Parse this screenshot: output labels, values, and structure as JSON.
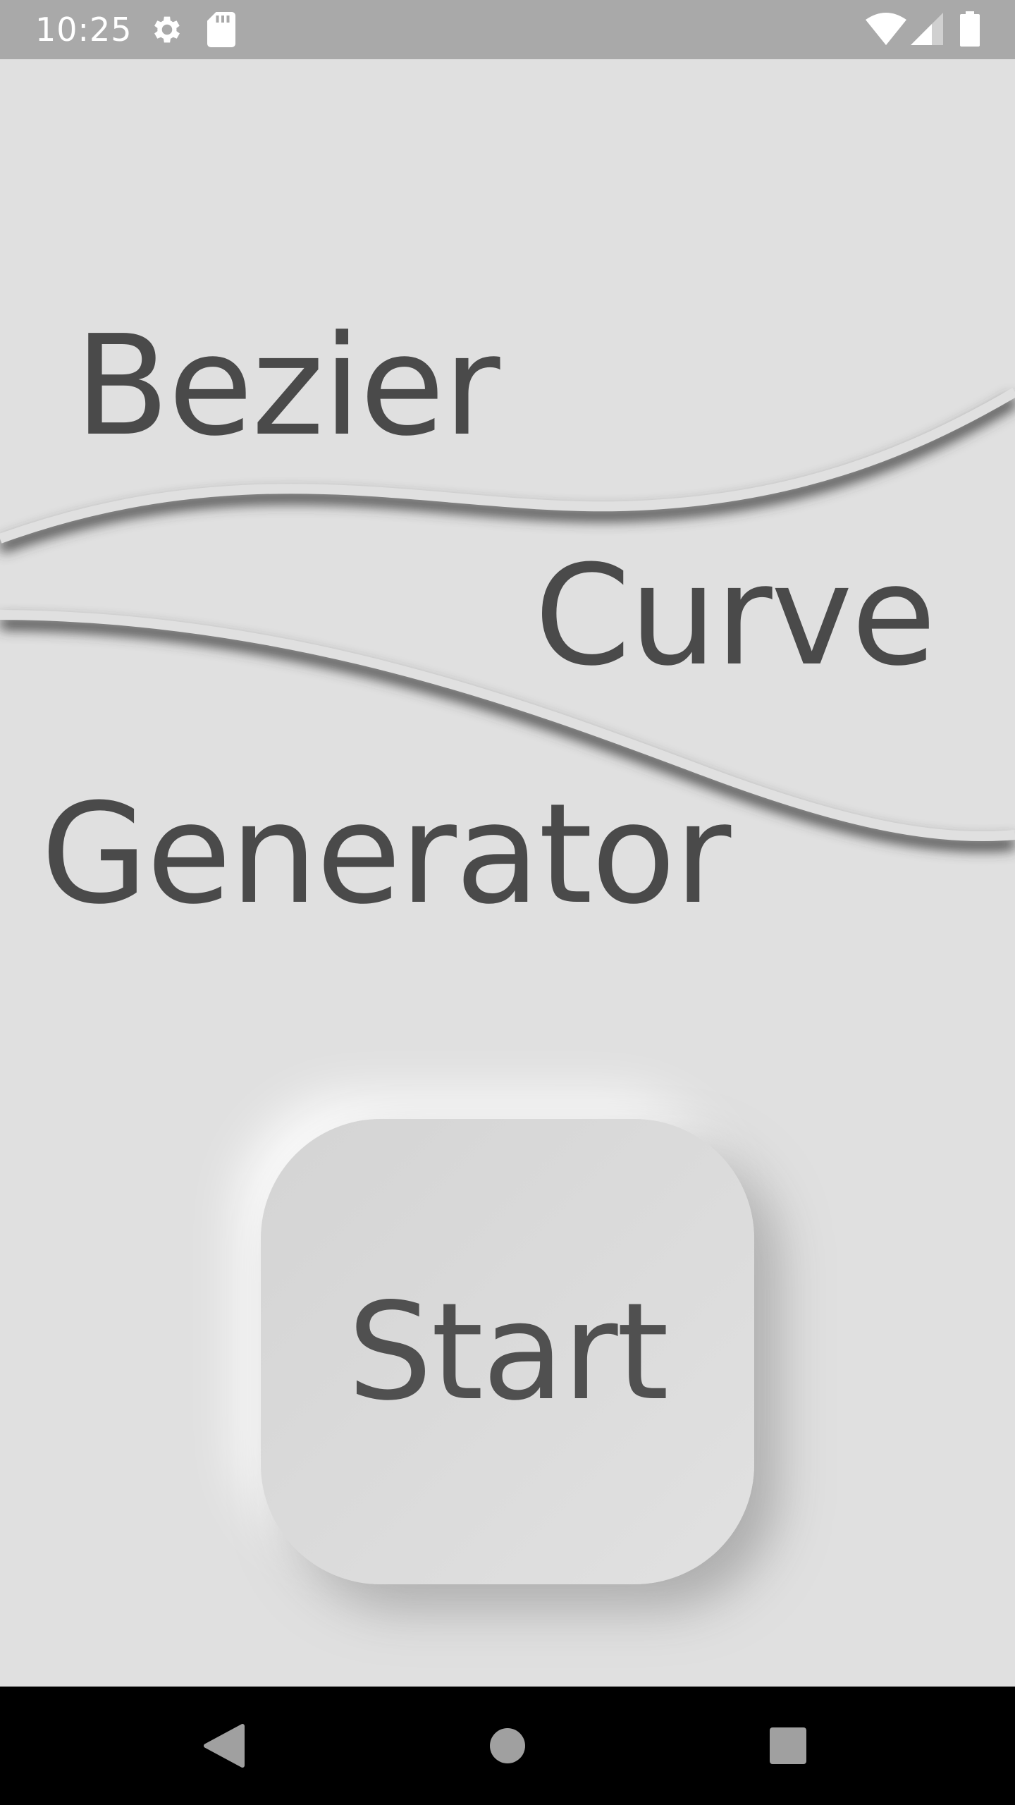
{
  "status_bar": {
    "time": "10:25",
    "icons": [
      "gear-icon",
      "sd-card-icon",
      "wifi-icon",
      "signal-icon",
      "battery-icon"
    ]
  },
  "title": {
    "line1": "Bezier",
    "line2": "Curve",
    "line3": "Generator"
  },
  "start_button": {
    "label": "Start"
  },
  "nav_bar": {
    "buttons": [
      "back-icon",
      "home-icon",
      "recents-icon"
    ]
  },
  "colors": {
    "background": "#e0e0e0",
    "text": "#4a4a4a",
    "status_bar": "#a9a9a9",
    "nav_bar": "#000000"
  }
}
